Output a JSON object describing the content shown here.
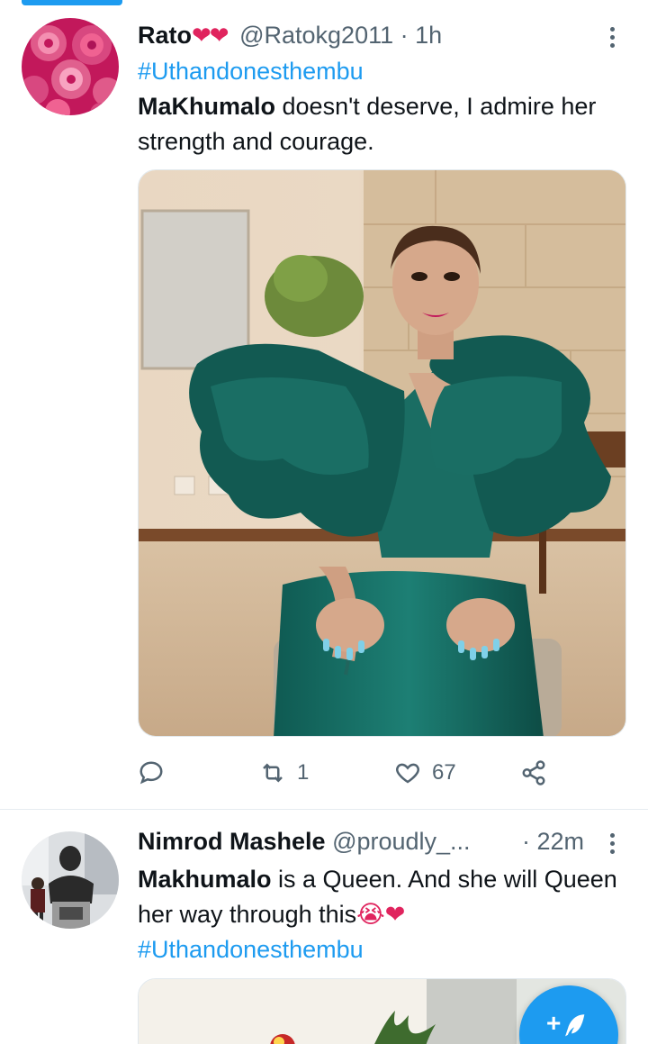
{
  "tweets": [
    {
      "author_name": "Rato",
      "name_emoji": "❤❤",
      "handle": "@Ratokg2011",
      "separator": "·",
      "time": "1h",
      "hashtag": "#Uthandonesthembu",
      "body_bold": "MaKhumalo",
      "body_rest": " doesn't deserve, I admire her strength and courage.",
      "reply_count": "",
      "retweet_count": "1",
      "like_count": "67"
    },
    {
      "author_name": "Nimrod Mashele",
      "handle": "@proudly_...",
      "separator": "·",
      "time": "22m",
      "body_bold": "Makhumalo",
      "body_rest": " is a Queen. And she will Queen her way through this",
      "body_emoji": "😭❤",
      "hashtag": "#Uthandonesthembu"
    }
  ],
  "fab": {
    "label": "+",
    "icon": "feather-icon"
  },
  "colors": {
    "accent": "#1d9bf0",
    "text": "#0f1419",
    "secondary": "#536471",
    "heart": "#e0245e"
  }
}
